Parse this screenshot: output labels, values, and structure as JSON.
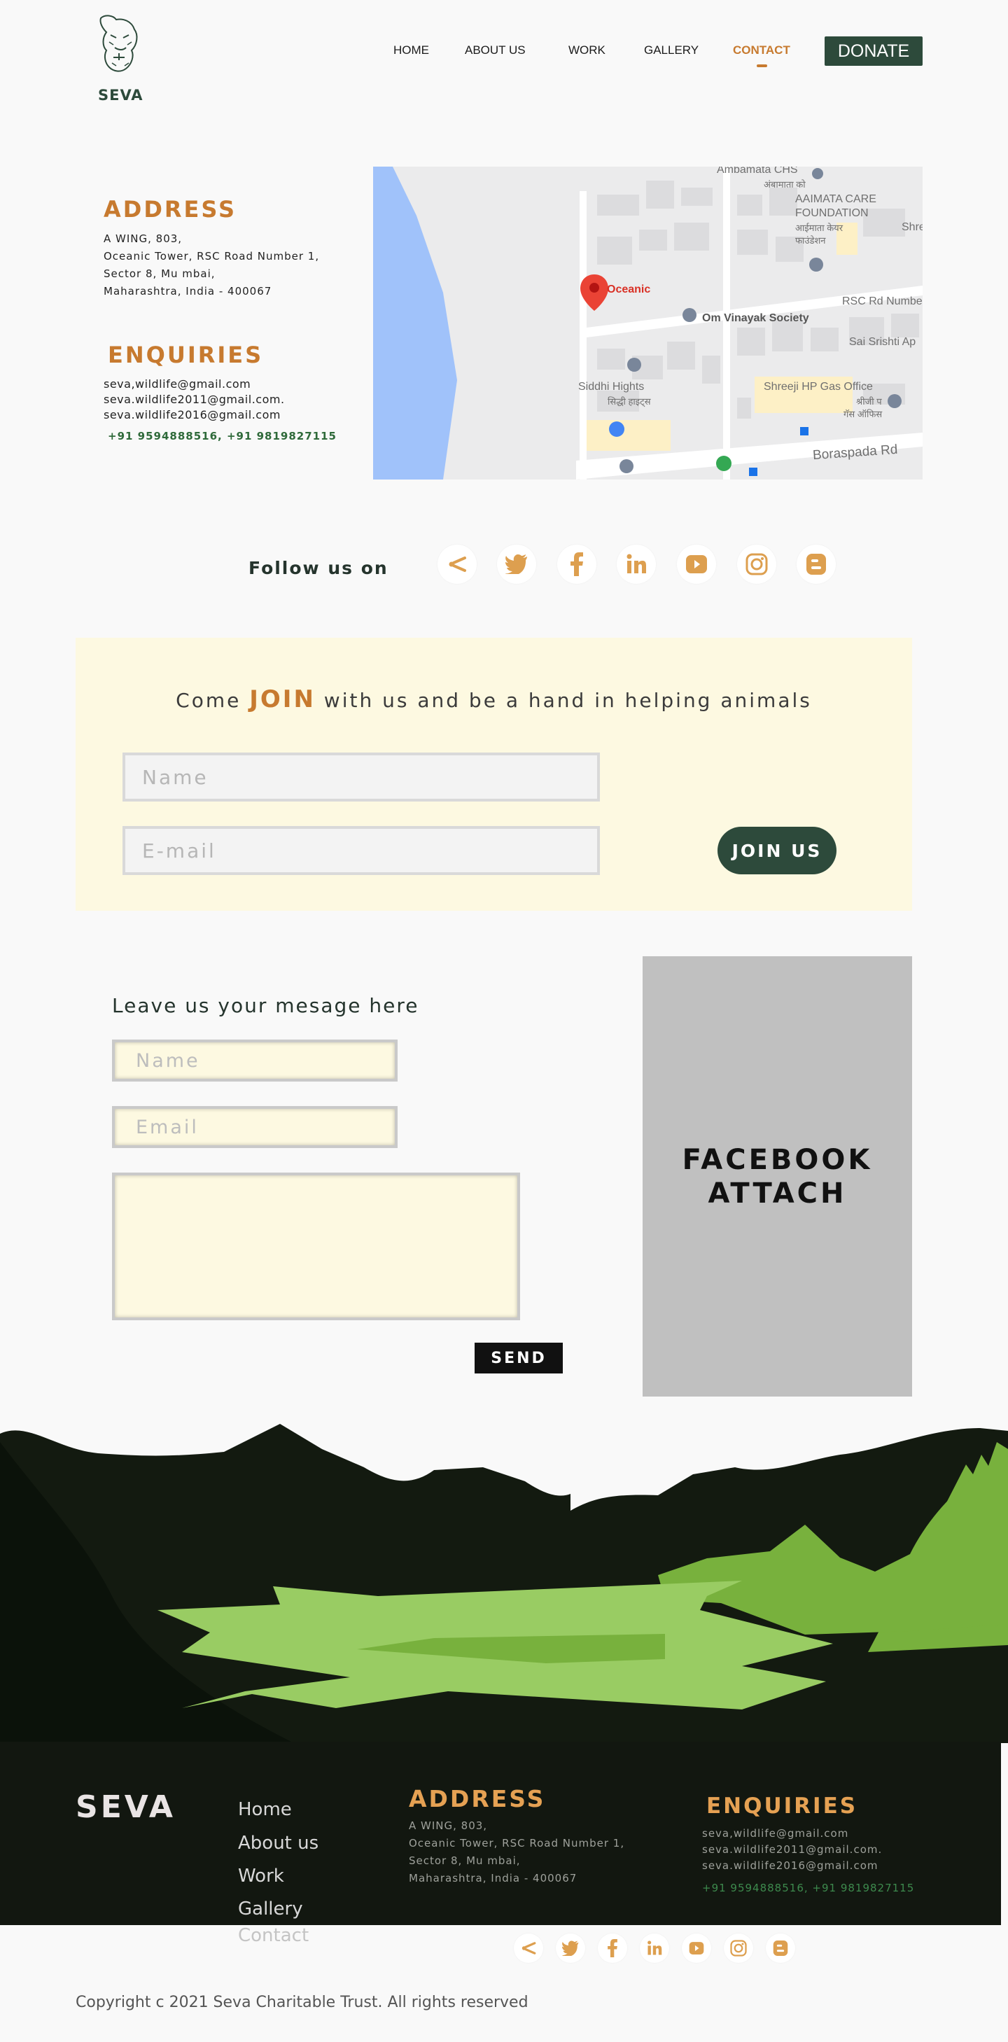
{
  "nav": {
    "logo_text": "SEVA",
    "items": [
      "HOME",
      "ABOUT US",
      "WORK",
      "GALLERY",
      "CONTACT"
    ],
    "active": "CONTACT",
    "donate": "DONATE"
  },
  "contact": {
    "address_heading": "ADDRESS",
    "address_lines": [
      "A WING, 803,",
      "Oceanic Tower, RSC Road Number 1,",
      "Sector 8, Mu mbai,",
      "Maharashtra, India - 400067"
    ],
    "enquiries_heading": "ENQUIRIES",
    "emails": [
      "seva,wildlife@gmail.com",
      "seva.wildlife2011@gmail.com.",
      "seva.wildlife2016@gmail.com"
    ],
    "phones": "+91 9594888516, +91 9819827115"
  },
  "map": {
    "labels": {
      "top": "Ambamata CHS",
      "top_sub": "अंबामाता को",
      "aaimata": "AAIMATA CARE",
      "foundation": "FOUNDATION",
      "aaimata_sub1": "आईमाता केयर",
      "aaimata_sub2": "फाउंडेशन",
      "shre": "Shre",
      "oceanic": "Oceanic",
      "om": "Om Vinayak Society",
      "rsc": "RSC Rd Numbe",
      "sai": "Sai Srishti Ap",
      "siddhi": "Siddhi Hights",
      "siddhi_sub": "सिद्धी हाइट्स",
      "shreeji": "Shreeji HP Gas Office",
      "shreeji_sub1": "श्रीजी प",
      "shreeji_sub2": "गॅस ऑफिस",
      "boraspada": "Boraspada Rd"
    }
  },
  "follow": {
    "title": "Follow us on",
    "icons": [
      "kutumb-icon",
      "twitter-icon",
      "facebook-icon",
      "linkedin-icon",
      "youtube-icon",
      "instagram-icon",
      "blogger-icon"
    ]
  },
  "join": {
    "title_pre": "Come ",
    "title_emph": "JOIN",
    "title_post": " with us and be a hand in helping animals",
    "name_placeholder": "Name",
    "email_placeholder": "E-mail",
    "button": "JOIN US"
  },
  "message": {
    "title": "Leave us your mesage here",
    "name_placeholder": "Name",
    "email_placeholder": "Email",
    "send": "SEND"
  },
  "facebook_box": {
    "line1": "FACEBOOK",
    "line2": "ATTACH"
  },
  "footer": {
    "brand": "SEVA",
    "links": [
      "Home",
      "About us",
      "Work",
      "Gallery",
      "Contact"
    ],
    "address_heading": "ADDRESS",
    "address_lines": [
      "A WING, 803,",
      "Oceanic Tower, RSC Road Number 1,",
      "Sector 8, Mu mbai,",
      "Maharashtra, India - 400067"
    ],
    "enquiries_heading": "ENQUIRIES",
    "emails": [
      "seva,wildlife@gmail.com",
      "seva.wildlife2011@gmail.com.",
      "seva.wildlife2016@gmail.com"
    ],
    "phones": "+91 9594888516, +91 9819827115",
    "copyright": "Copyright  c 2021 Seva Charitable Trust. All rights reserved"
  },
  "colors": {
    "accent": "#c77a2f",
    "dark_green": "#2d4a3b",
    "cream": "#fdf9e1",
    "footer_bg": "#121710",
    "grass_light": "#99cc63",
    "grass_mid": "#78b13d"
  }
}
